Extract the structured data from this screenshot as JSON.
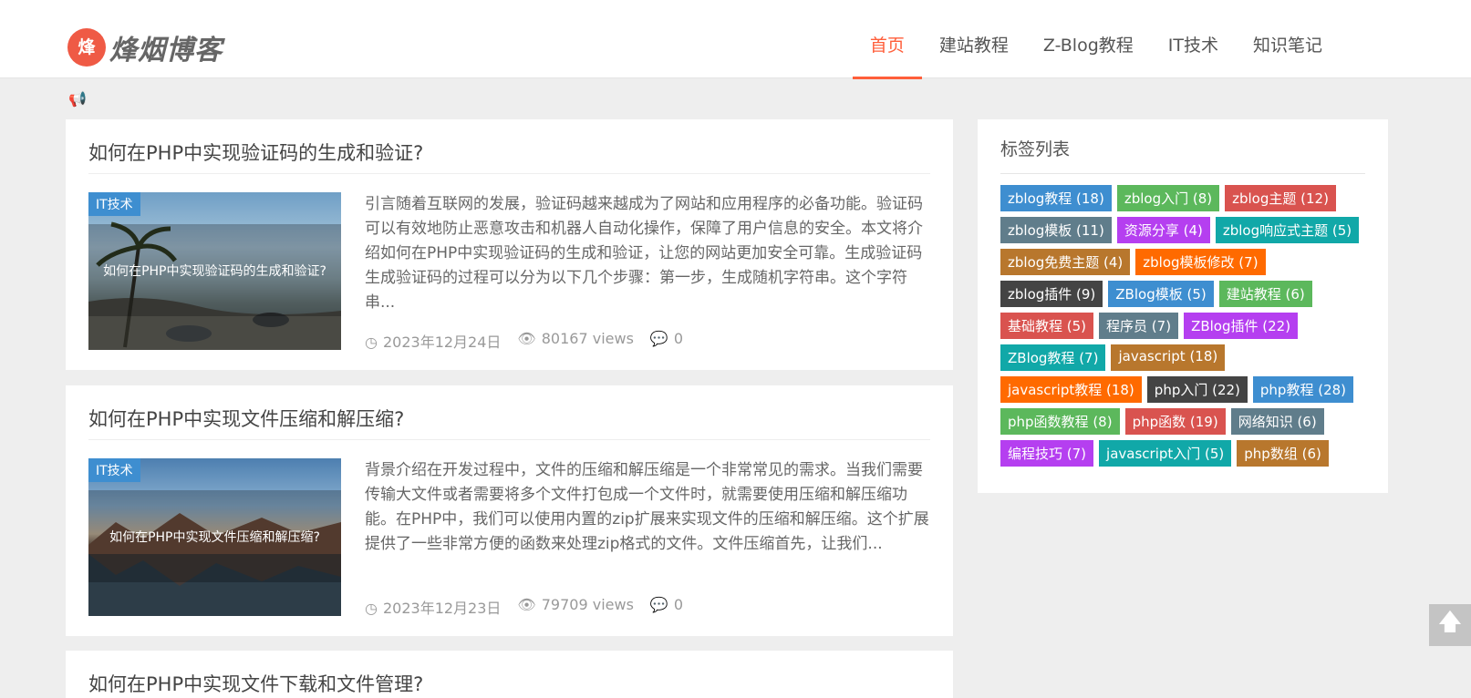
{
  "header": {
    "logo_glyph": "烽",
    "logo_text": "烽烟博客",
    "nav": [
      {
        "label": "首页",
        "active": true
      },
      {
        "label": "建站教程",
        "active": false
      },
      {
        "label": "Z-Blog教程",
        "active": false
      },
      {
        "label": "IT技术",
        "active": false
      },
      {
        "label": "知识笔记",
        "active": false
      }
    ]
  },
  "notice": {
    "icon": "megaphone-icon",
    "glyph": "📢"
  },
  "posts": [
    {
      "title": "如何在PHP中实现验证码的生成和验证?",
      "category": "IT技术",
      "thumb_caption": "如何在PHP中实现验证码的生成和验证?",
      "excerpt": "引言随着互联网的发展，验证码越来越成为了网站和应用程序的必备功能。验证码可以有效地防止恶意攻击和机器人自动化操作，保障了用户信息的安全。本文将介绍如何在PHP中实现验证码的生成和验证，让您的网站更加安全可靠。生成验证码生成验证码的过程可以分为以下几个步骤：第一步，生成随机字符串。这个字符串...",
      "date": "2023年12月24日",
      "views": "80167 views",
      "comments": "0"
    },
    {
      "title": "如何在PHP中实现文件压缩和解压缩?",
      "category": "IT技术",
      "thumb_caption": "如何在PHP中实现文件压缩和解压缩?",
      "excerpt": "背景介绍在开发过程中，文件的压缩和解压缩是一个非常常见的需求。当我们需要传输大文件或者需要将多个文件打包成一个文件时，就需要使用压缩和解压缩功能。在PHP中，我们可以使用内置的zip扩展来实现文件的压缩和解压缩。这个扩展提供了一些非常方便的函数来处理zip格式的文件。文件压缩首先，让我们...",
      "date": "2023年12月23日",
      "views": "79709 views",
      "comments": "0"
    },
    {
      "title": "如何在PHP中实现文件下载和文件管理?"
    }
  ],
  "sidebar": {
    "title": "标签列表",
    "tags": [
      {
        "label": "zblog教程 (18)",
        "color": "#3e8ed0"
      },
      {
        "label": "zblog入门 (8)",
        "color": "#5cb85c"
      },
      {
        "label": "zblog主题 (12)",
        "color": "#d9534f"
      },
      {
        "label": "zblog模板 (11)",
        "color": "#607d8b"
      },
      {
        "label": "资源分享 (4)",
        "color": "#b53ff0"
      },
      {
        "label": "zblog响应式主题 (5)",
        "color": "#11a8a8"
      },
      {
        "label": "zblog免费主题 (4)",
        "color": "#b8772d"
      },
      {
        "label": "zblog模板修改 (7)",
        "color": "#ff6a00"
      },
      {
        "label": "zblog插件 (9)",
        "color": "#444444"
      },
      {
        "label": "ZBlog模板 (5)",
        "color": "#3e8ed0"
      },
      {
        "label": "建站教程 (6)",
        "color": "#5cb85c"
      },
      {
        "label": "基础教程 (5)",
        "color": "#d9534f"
      },
      {
        "label": "程序员 (7)",
        "color": "#607d8b"
      },
      {
        "label": "ZBlog插件 (22)",
        "color": "#b53ff0"
      },
      {
        "label": "ZBlog教程 (7)",
        "color": "#11a8a8"
      },
      {
        "label": "javascript (18)",
        "color": "#b8772d"
      },
      {
        "label": "javascript教程 (18)",
        "color": "#ff6a00"
      },
      {
        "label": "php入门 (22)",
        "color": "#444444"
      },
      {
        "label": "php教程 (28)",
        "color": "#3e8ed0"
      },
      {
        "label": "php函数教程 (8)",
        "color": "#5cb85c"
      },
      {
        "label": "php函数 (19)",
        "color": "#d9534f"
      },
      {
        "label": "网络知识 (6)",
        "color": "#607d8b"
      },
      {
        "label": "编程技巧 (7)",
        "color": "#b53ff0"
      },
      {
        "label": "javascript入门 (5)",
        "color": "#11a8a8"
      },
      {
        "label": "php数组 (6)",
        "color": "#b8772d"
      }
    ]
  },
  "back_to_top": {
    "icon": "arrow-up-icon",
    "glyph": "🡅"
  },
  "meta_icons": {
    "date": "◷",
    "views": "👁",
    "comments": "💬"
  }
}
